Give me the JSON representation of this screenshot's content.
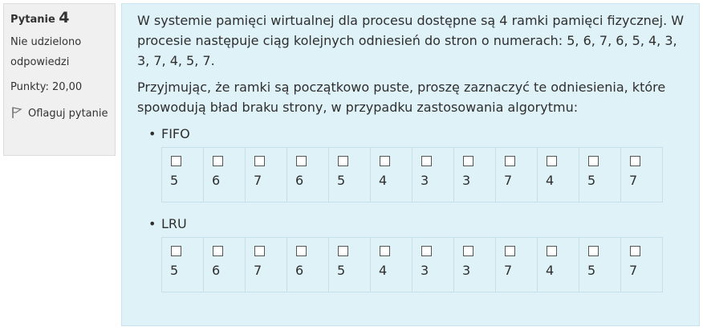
{
  "info": {
    "question_label": "Pytanie",
    "question_number": "4",
    "state": "Nie udzielono odpowiedzi",
    "grade": "Punkty: 20,00",
    "flag_label": "Oflaguj pytanie"
  },
  "question": {
    "para1": "W systemie pamięci wirtualnej dla procesu dostępne są 4 ramki pamięci fizycznej. W procesie następuje ciąg kolejnych odniesień do stron o numerach: 5, 6, 7, 6, 5, 4, 3, 3, 7, 4, 5, 7.",
    "para2": "Przyjmując, że ramki są początkowo puste, proszę zaznaczyć te odniesienia, które spowodują bład braku strony, w przypadku zastosowania algorytmu:"
  },
  "fifo": {
    "label": "FIFO",
    "values": [
      "5",
      "6",
      "7",
      "6",
      "5",
      "4",
      "3",
      "3",
      "7",
      "4",
      "5",
      "7"
    ]
  },
  "lru": {
    "label": "LRU",
    "values": [
      "5",
      "6",
      "7",
      "6",
      "5",
      "4",
      "3",
      "3",
      "7",
      "4",
      "5",
      "7"
    ]
  }
}
